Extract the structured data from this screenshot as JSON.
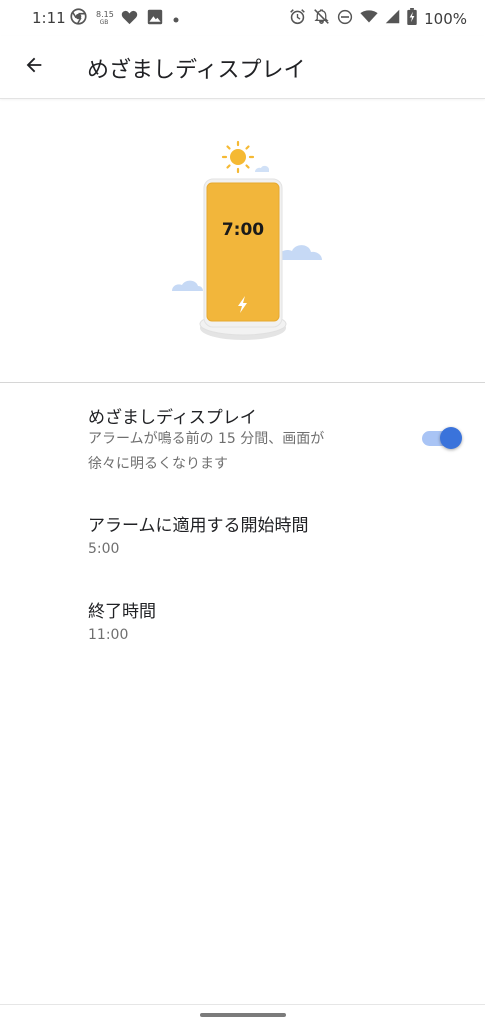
{
  "status_bar": {
    "time": "1:11",
    "net_speed_value": "8.15",
    "net_speed_unit": "GB",
    "battery_text": "100%",
    "icons": [
      "chrome-icon",
      "heart-icon",
      "image-icon",
      "dot-icon",
      "alarm-icon",
      "notifications-off-icon",
      "do-not-disturb-icon",
      "wifi-icon",
      "signal-icon",
      "battery-charging-icon"
    ]
  },
  "app_bar": {
    "back_icon": "arrow-back-icon",
    "title": "めざましディスプレイ"
  },
  "illustration": {
    "clock_text": "7:00",
    "colors": {
      "phone": "#F2B63B",
      "sun": "#F5B933",
      "cloud": "#C6D9F5"
    }
  },
  "settings": {
    "bedtime_display": {
      "title": "めざましディスプレイ",
      "summary_line1": "アラームが鳴る前の 15 分間、画面が",
      "summary_line2": "徐々に明るくなります",
      "enabled": true
    },
    "start_time": {
      "title": "アラームに適用する開始時間",
      "value": "5:00"
    },
    "end_time": {
      "title": "終了時間",
      "value": "11:00"
    }
  },
  "colors": {
    "accent": "#3A73DB",
    "accent_track": "#A9C4F5"
  }
}
